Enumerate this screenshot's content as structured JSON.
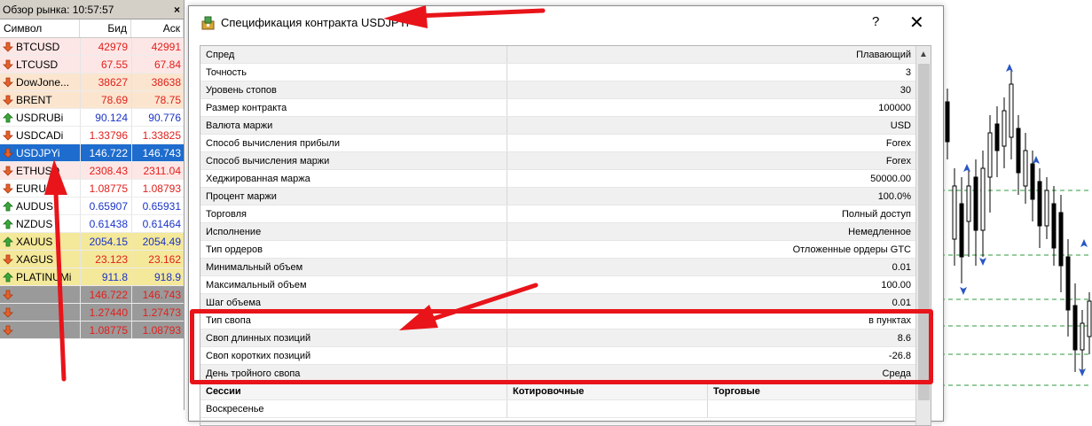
{
  "market_watch": {
    "title": "Обзор рынка: 10:57:57",
    "close_label": "×",
    "columns": {
      "symbol": "Символ",
      "bid": "Бид",
      "ask": "Аск"
    },
    "rows": [
      {
        "symbol": "BTCUSD",
        "bid": "42979",
        "ask": "42991",
        "dir": "down",
        "color": "red",
        "bg": "pink"
      },
      {
        "symbol": "LTCUSD",
        "bid": "67.55",
        "ask": "67.84",
        "dir": "down",
        "color": "red",
        "bg": "pink"
      },
      {
        "symbol": "DowJone...",
        "bid": "38627",
        "ask": "38638",
        "dir": "down",
        "color": "red",
        "bg": "orange"
      },
      {
        "symbol": "BRENT",
        "bid": "78.69",
        "ask": "78.75",
        "dir": "down",
        "color": "red",
        "bg": "orange"
      },
      {
        "symbol": "USDRUBi",
        "bid": "90.124",
        "ask": "90.776",
        "dir": "up",
        "color": "blue",
        "bg": "white"
      },
      {
        "symbol": "USDCADi",
        "bid": "1.33796",
        "ask": "1.33825",
        "dir": "down",
        "color": "red",
        "bg": "white"
      },
      {
        "symbol": "USDJPYi",
        "bid": "146.722",
        "ask": "146.743",
        "dir": "down",
        "color": "red",
        "bg": "sel"
      },
      {
        "symbol": "ETHUSD",
        "bid": "2308.43",
        "ask": "2311.04",
        "dir": "down",
        "color": "red",
        "bg": "pink"
      },
      {
        "symbol": "EURUS",
        "bid": "1.08775",
        "ask": "1.08793",
        "dir": "down",
        "color": "red",
        "bg": "white"
      },
      {
        "symbol": "AUDUS",
        "bid": "0.65907",
        "ask": "0.65931",
        "dir": "up",
        "color": "blue",
        "bg": "white"
      },
      {
        "symbol": "NZDUS",
        "bid": "0.61438",
        "ask": "0.61464",
        "dir": "up",
        "color": "blue",
        "bg": "white"
      },
      {
        "symbol": "XAUUS",
        "bid": "2054.15",
        "ask": "2054.49",
        "dir": "up",
        "color": "blue",
        "bg": "yellow"
      },
      {
        "symbol": "XAGUS",
        "bid": "23.123",
        "ask": "23.162",
        "dir": "down",
        "color": "red",
        "bg": "yellow"
      },
      {
        "symbol": "PLATINUMi",
        "bid": "911.8",
        "ask": "918.9",
        "dir": "up",
        "color": "blue",
        "bg": "yellow"
      },
      {
        "symbol": "",
        "bid": "146.722",
        "ask": "146.743",
        "dir": "down",
        "color": "red",
        "bg": "gray"
      },
      {
        "symbol": "",
        "bid": "1.27440",
        "ask": "1.27473",
        "dir": "down",
        "color": "red",
        "bg": "gray"
      },
      {
        "symbol": "",
        "bid": "1.08775",
        "ask": "1.08793",
        "dir": "down",
        "color": "red",
        "bg": "gray"
      }
    ]
  },
  "dialog": {
    "title": "Спецификация контракта USDJPYi",
    "help_label": "?",
    "close_label": "✕",
    "spec_rows": [
      {
        "key": "Спред",
        "value": "Плавающий"
      },
      {
        "key": "Точность",
        "value": "3"
      },
      {
        "key": "Уровень стопов",
        "value": "30"
      },
      {
        "key": "Размер контракта",
        "value": "100000"
      },
      {
        "key": "Валюта маржи",
        "value": "USD"
      },
      {
        "key": "Способ вычисления прибыли",
        "value": "Forex"
      },
      {
        "key": "Способ вычисления маржи",
        "value": "Forex"
      },
      {
        "key": "Хеджированная маржа",
        "value": "50000.00"
      },
      {
        "key": "Процент маржи",
        "value": "100.0%"
      },
      {
        "key": "Торговля",
        "value": "Полный доступ"
      },
      {
        "key": "Исполнение",
        "value": "Немедленное"
      },
      {
        "key": "Тип ордеров",
        "value": "Отложенные ордеры GTC"
      },
      {
        "key": "Минимальный объем",
        "value": "0.01"
      },
      {
        "key": "Максимальный объем",
        "value": "100.00"
      },
      {
        "key": "Шаг объема",
        "value": "0.01"
      },
      {
        "key": "Тип свопа",
        "value": "в пунктах"
      },
      {
        "key": "Своп длинных позиций",
        "value": "8.6"
      },
      {
        "key": "Своп коротких позиций",
        "value": "-26.8"
      },
      {
        "key": "День тройного свопа",
        "value": "Среда"
      }
    ],
    "sessions": {
      "headers": [
        "Сессии",
        "Котировочные",
        "Торговые"
      ],
      "rows": [
        [
          "Воскресенье",
          "",
          ""
        ]
      ]
    }
  },
  "colors": {
    "annotation": "#e8141a",
    "selected": "#1e6ccd",
    "price_down": "#e0201c",
    "price_up": "#1a33c8"
  }
}
